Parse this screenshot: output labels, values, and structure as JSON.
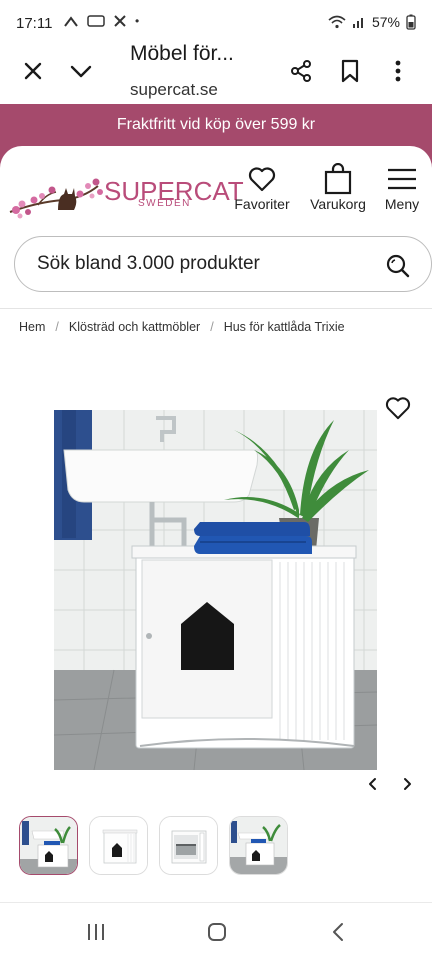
{
  "status_bar": {
    "time": "17:11",
    "battery": "57%",
    "dot": "•"
  },
  "browser": {
    "title": "Möbel för...",
    "url": "supercat.se",
    "icons": [
      "close-icon",
      "chevron-down-icon",
      "share-icon",
      "bookmark-icon",
      "more-icon"
    ]
  },
  "promo": {
    "text": "Fraktfritt vid köp över 599 kr"
  },
  "header": {
    "logo": {
      "name": "SUPERCAT",
      "tagline": "SWEDEN"
    },
    "nav": [
      {
        "label": "Favoriter",
        "icon": "heart-icon"
      },
      {
        "label": "Varukorg",
        "icon": "bag-icon"
      },
      {
        "label": "Meny",
        "icon": "menu-icon"
      }
    ]
  },
  "search": {
    "placeholder": "Sök bland 3.000 produkter"
  },
  "breadcrumb": [
    "Hem",
    "Klösträd och kattmöbler",
    "Hus för kattlåda Trixie"
  ],
  "gallery": {
    "thumbnail_count": 4
  },
  "colors": {
    "brand": "#a54a6c",
    "logo": "#b94c7a"
  }
}
